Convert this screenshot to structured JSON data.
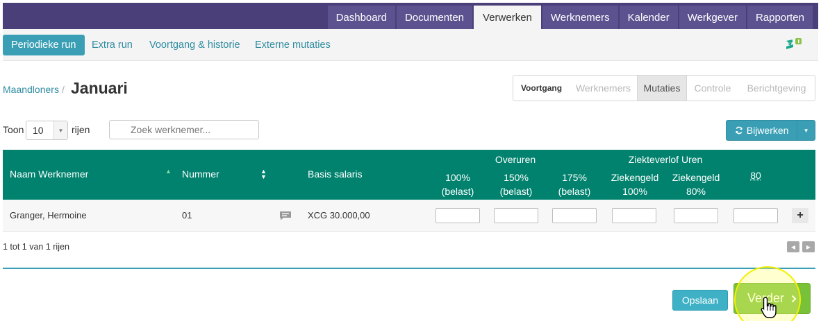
{
  "nav": {
    "tabs": [
      {
        "label": "Dashboard",
        "active": false
      },
      {
        "label": "Documenten",
        "active": false
      },
      {
        "label": "Verwerken",
        "active": true
      },
      {
        "label": "Werknemers",
        "active": false
      },
      {
        "label": "Kalender",
        "active": false
      },
      {
        "label": "Werkgever",
        "active": false
      },
      {
        "label": "Rapporten",
        "active": false
      }
    ]
  },
  "subnav": {
    "items": [
      {
        "label": "Periodieke run",
        "active": true
      },
      {
        "label": "Extra run",
        "active": false
      },
      {
        "label": "Voortgang & historie",
        "active": false
      },
      {
        "label": "Externe mutaties",
        "active": false
      }
    ],
    "logo_icon": "app-logo-icon"
  },
  "page": {
    "breadcrumb": "Maandloners",
    "breadcrumb_sep": "/",
    "title": "Januari"
  },
  "steps": {
    "items": [
      "Voortgang",
      "Werknemers",
      "Mutaties",
      "Controle",
      "Berichtgeving"
    ],
    "current": "Mutaties"
  },
  "controls": {
    "show_label": "Toon",
    "rows_value": "10",
    "rows_label": "rijen",
    "search_placeholder": "Zoek werknemer...",
    "refresh_label": "Bijwerken"
  },
  "table": {
    "headers": {
      "name": "Naam Werknemer",
      "number": "Nummer",
      "salary": "Basis salaris",
      "overtime_group": "Overuren",
      "ot100": "100%",
      "ot150": "150%",
      "ot175": "175%",
      "taxed": "(belast)",
      "sick_group": "Ziekteverlof Uren",
      "sick100_a": "Ziekengeld",
      "sick100_b": "100%",
      "sick80_a": "Ziekengeld",
      "sick80_b": "80%",
      "extra": "80"
    },
    "rows": [
      {
        "name": "Granger, Hermoine",
        "number": "01",
        "salary": "XCG 30.000,00"
      }
    ],
    "info": "1 tot 1 van 1 rijen"
  },
  "footer": {
    "save_label": "Opslaan",
    "next_label": "Verder"
  },
  "colors": {
    "nav_bg": "#4a3f78",
    "accent": "#3a9fb5",
    "table_header": "#00826e",
    "next_button": "#7ac13a"
  }
}
